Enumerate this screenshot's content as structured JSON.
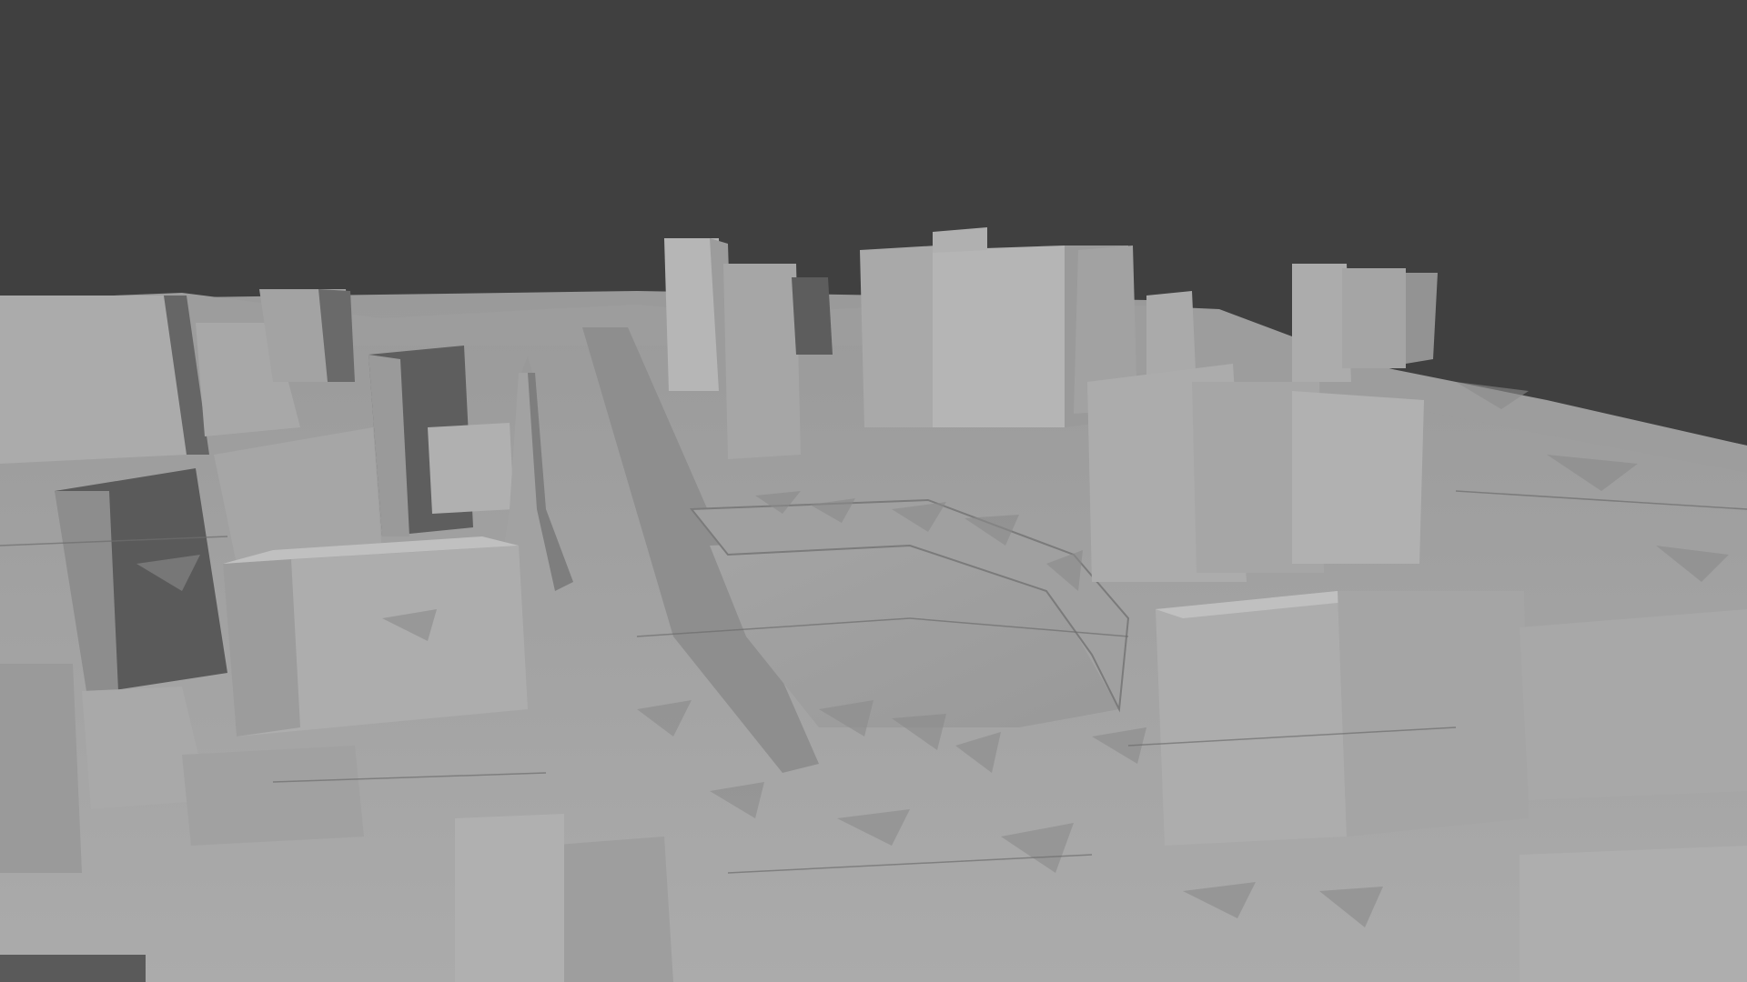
{
  "scene": {
    "background_color": "#404040",
    "ground_color": "#a6a6a6",
    "ground_dark_color": "#8f8f8f",
    "building_light_color": "#b3b3b3",
    "building_mid_color": "#9c9c9c",
    "building_dark_color": "#565656",
    "edge_color": "#6e6e6e"
  }
}
